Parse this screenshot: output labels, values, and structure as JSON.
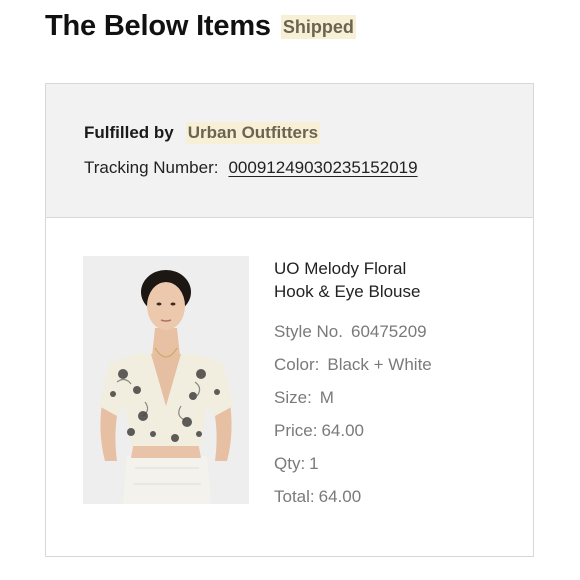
{
  "heading": {
    "title": "The Below Items",
    "status": "Shipped"
  },
  "fulfillment": {
    "label": "Fulfilled by",
    "vendor": "Urban Outfitters",
    "tracking_label": "Tracking Number:",
    "tracking_number": "00091249030235152019"
  },
  "product": {
    "title_line1": "UO Melody Floral",
    "title_line2": "Hook & Eye Blouse",
    "style_label": "Style No.",
    "style_value": "60475209",
    "color_label": "Color:",
    "color_value": "Black + White",
    "size_label": "Size:",
    "size_value": "M",
    "price_label": "Price:",
    "price_value": "64.00",
    "qty_label": "Qty:",
    "qty_value": "1",
    "total_label": "Total:",
    "total_value": "64.00"
  },
  "colors": {
    "badge_bg": "#f8f0d6",
    "badge_text": "#6b6450",
    "header_bg": "#f2f2f2"
  }
}
